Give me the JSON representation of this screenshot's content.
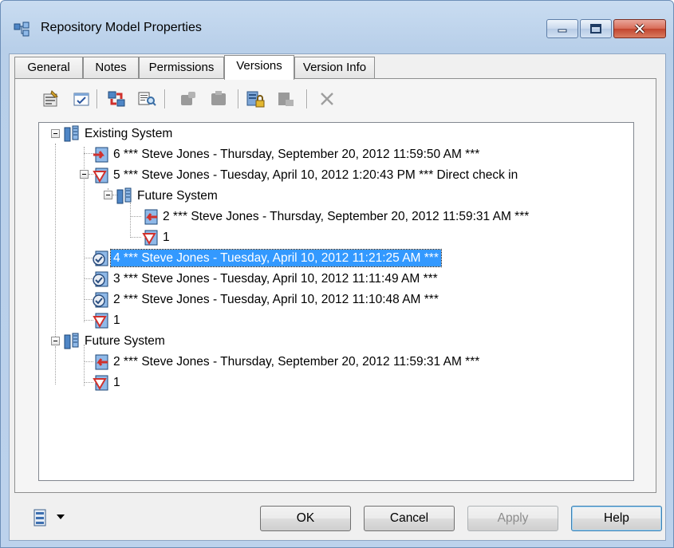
{
  "window": {
    "title": "Repository Model Properties"
  },
  "tabs": [
    {
      "label": "General"
    },
    {
      "label": "Notes"
    },
    {
      "label": "Permissions"
    },
    {
      "label": "Versions"
    },
    {
      "label": "Version Info"
    }
  ],
  "active_tab": "Versions",
  "toolbar": {
    "icons": [
      "properties-icon",
      "check-version-icon",
      "compare-icon",
      "report-icon",
      "consolidate-icon",
      "extract-icon",
      "lock-icon",
      "unlock-icon",
      "delete-icon"
    ]
  },
  "tree": {
    "rows": [
      {
        "label": "Existing System",
        "type": "branch"
      },
      {
        "label": "6 *** Steve Jones - Thursday, September 20, 2012 11:59:50 AM ***",
        "type": "branched-version"
      },
      {
        "label": "5 *** Steve Jones - Tuesday, April 10, 2012 1:20:43 PM *** Direct check in",
        "type": "initial-version"
      },
      {
        "label": "Future System",
        "type": "branch"
      },
      {
        "label": "2 *** Steve Jones - Thursday, September 20, 2012 11:59:31 AM ***",
        "type": "branched-version"
      },
      {
        "label": "1",
        "type": "initial-version"
      },
      {
        "label": "4 *** Steve Jones - Tuesday, April 10, 2012 11:21:25 AM ***",
        "type": "version",
        "selected": true
      },
      {
        "label": "3 *** Steve Jones - Tuesday, April 10, 2012 11:11:49 AM ***",
        "type": "version"
      },
      {
        "label": "2 *** Steve Jones - Tuesday, April 10, 2012 11:10:48 AM ***",
        "type": "version"
      },
      {
        "label": "1",
        "type": "initial-version"
      },
      {
        "label": "Future System",
        "type": "branch"
      },
      {
        "label": "2 *** Steve Jones - Thursday, September 20, 2012 11:59:31 AM ***",
        "type": "branched-version"
      },
      {
        "label": "1",
        "type": "initial-version"
      }
    ]
  },
  "buttons": {
    "ok": "OK",
    "cancel": "Cancel",
    "apply": "Apply",
    "help": "Help"
  },
  "colors": {
    "selection": "#3399ff",
    "close_button": "#c2452f",
    "title_gradient": "#c9dcf1"
  }
}
